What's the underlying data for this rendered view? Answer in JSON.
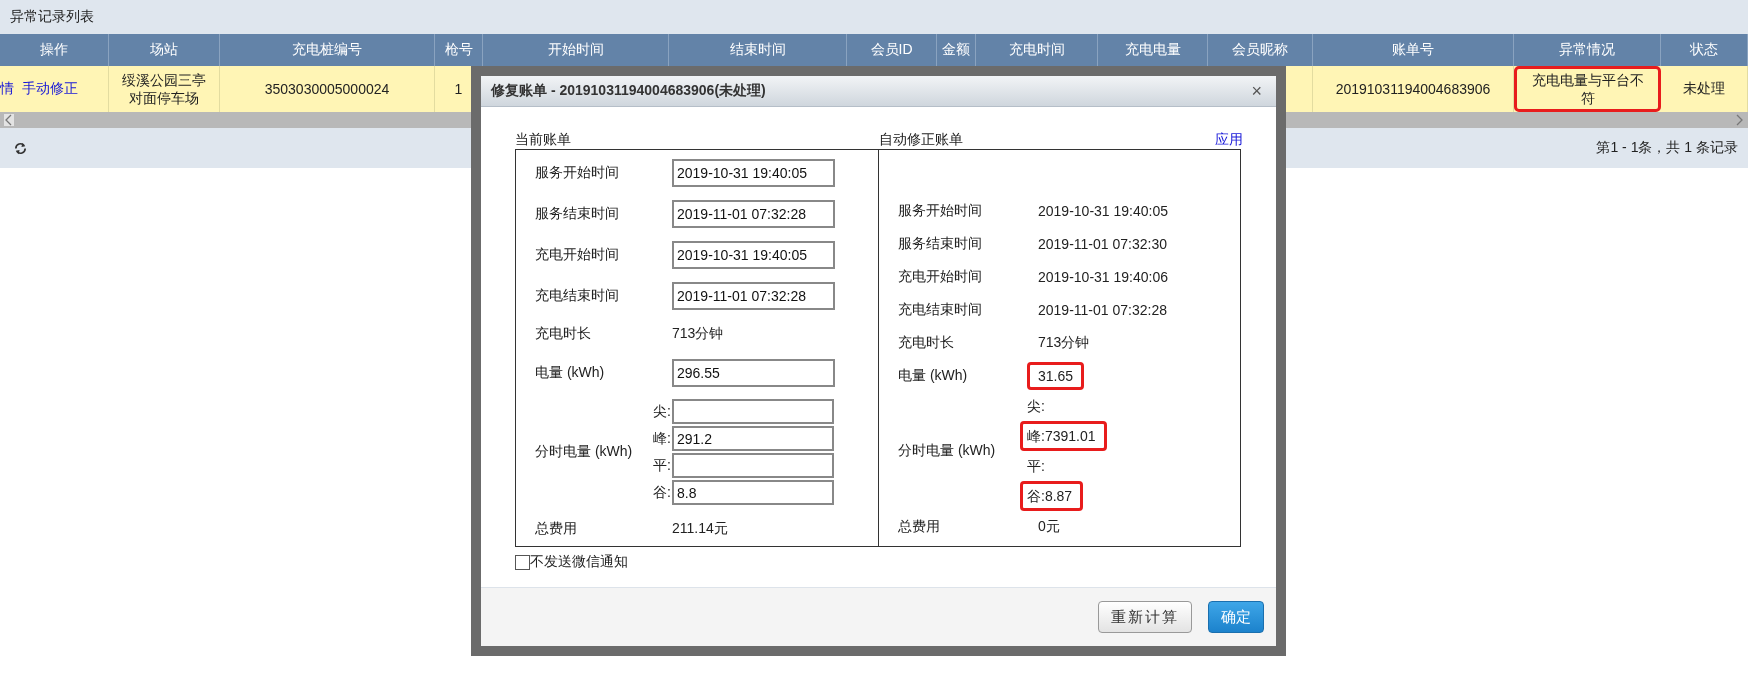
{
  "list_title": "异常记录列表",
  "table": {
    "columns": [
      "操作",
      "场站",
      "充电桩编号",
      "枪号",
      "开始时间",
      "结束时间",
      "会员ID",
      "金额",
      "充电时间",
      "充电电量",
      "会员昵称",
      "账单号",
      "异常情况",
      "状态"
    ],
    "rows": [
      {
        "selected": true,
        "actions": [
          "情",
          "手动修正"
        ],
        "station": "绥溪公园三亭对面停车场",
        "pile_no": "3503030005000024",
        "gun_no": "1",
        "bill_no": "20191031194004683906",
        "anomaly": {
          "text": "充电电量与平台不符",
          "highlighted": true
        },
        "status": "未处理"
      }
    ]
  },
  "pagination": "第1 - 1条，共 1 条记录",
  "dialog": {
    "title": "修复账单 - 20191031194004683906(未处理)",
    "close": "×",
    "current": {
      "heading": "当前账单",
      "fields": [
        {
          "kind": "input",
          "label": "服务开始时间",
          "value": "2019-10-31 19:40:05"
        },
        {
          "kind": "input",
          "label": "服务结束时间",
          "value": "2019-11-01 07:32:28"
        },
        {
          "kind": "input",
          "label": "充电开始时间",
          "value": "2019-10-31 19:40:05"
        },
        {
          "kind": "input",
          "label": "充电结束时间",
          "value": "2019-11-01 07:32:28"
        },
        {
          "kind": "text",
          "label": "充电时长",
          "value": "713分钟"
        },
        {
          "kind": "input",
          "label": "电量 (kWh)",
          "value": "296.55"
        },
        {
          "kind": "tou",
          "label": "分时电量 (kWh)",
          "parts": [
            {
              "label": "尖:"
            },
            {
              "label": "峰:",
              "value": "291.2"
            },
            {
              "label": "平:"
            },
            {
              "label": "谷:",
              "value": "8.8"
            }
          ]
        },
        {
          "kind": "text",
          "label": "总费用",
          "value": "211.14元"
        }
      ]
    },
    "corrected": {
      "heading": "自动修正账单",
      "apply": "应用",
      "fields": [
        {
          "kind": "text",
          "label": "服务开始时间",
          "value": "2019-10-31 19:40:05",
          "highlighted": false
        },
        {
          "kind": "text",
          "label": "服务结束时间",
          "value": "2019-11-01 07:32:30",
          "highlighted": false
        },
        {
          "kind": "text",
          "label": "充电开始时间",
          "value": "2019-10-31 19:40:06",
          "highlighted": false
        },
        {
          "kind": "text",
          "label": "充电结束时间",
          "value": "2019-11-01 07:32:28",
          "highlighted": false
        },
        {
          "kind": "text",
          "label": "充电时长",
          "value": "713分钟",
          "highlighted": false
        },
        {
          "kind": "text",
          "label": "电量 (kWh)",
          "value": "31.65",
          "highlighted": true
        },
        {
          "kind": "tou",
          "label": "分时电量 (kWh)",
          "parts": [
            {
              "label": "尖:",
              "highlighted": false
            },
            {
              "label": "峰:",
              "value": "7391.01",
              "highlighted": true
            },
            {
              "label": "平:",
              "highlighted": false
            },
            {
              "label": "谷:",
              "value": "8.87",
              "highlighted": true
            }
          ]
        },
        {
          "kind": "text",
          "label": "总费用",
          "value": "0元",
          "highlighted": false
        }
      ]
    },
    "notify": {
      "label": "不发送微信通知",
      "checked": false
    },
    "buttons": [
      {
        "label": "重新计算",
        "primary": false
      },
      {
        "label": "确定",
        "primary": true
      }
    ]
  }
}
